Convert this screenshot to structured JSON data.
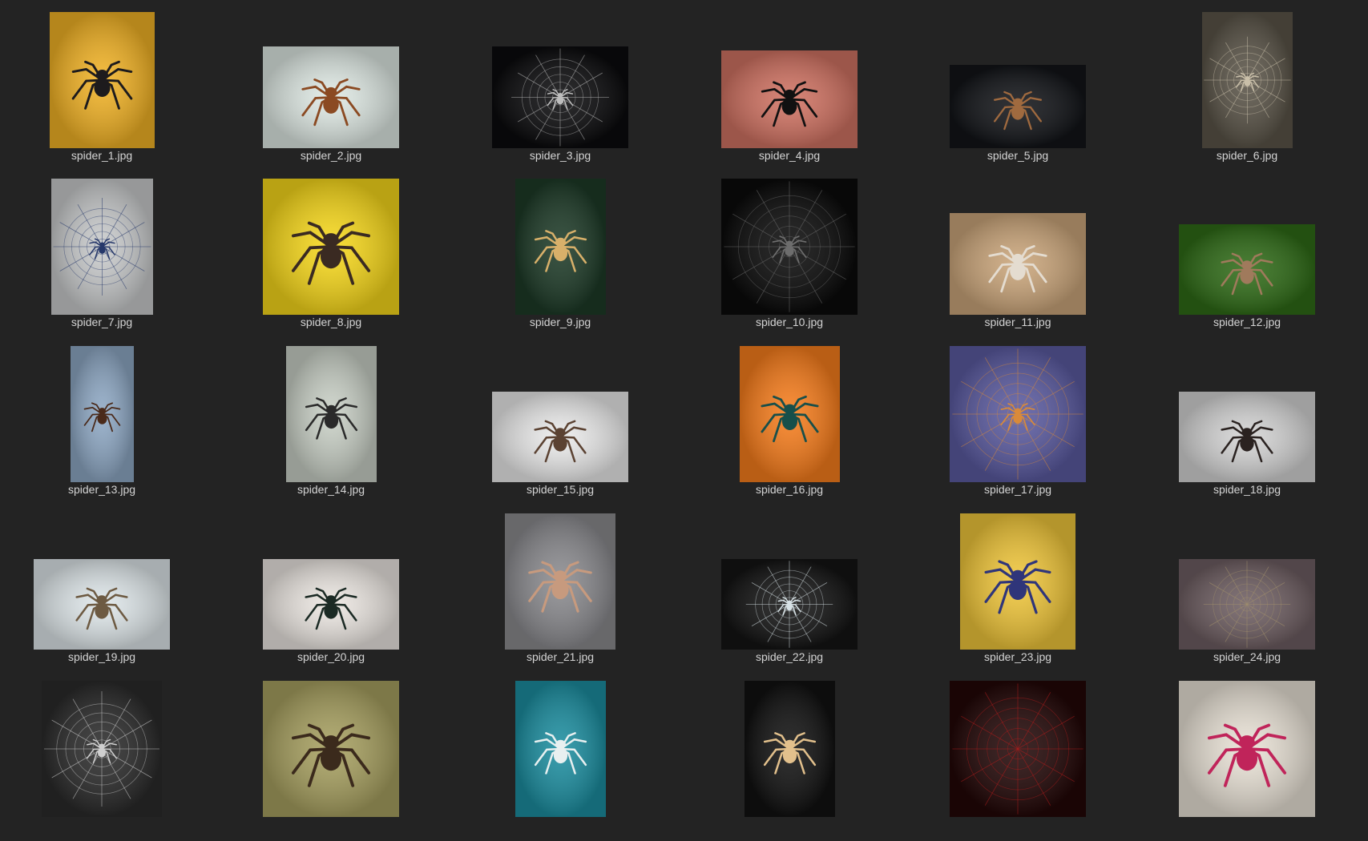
{
  "window": {
    "title": ""
  },
  "files": [
    {
      "name": "spider_1.jpg",
      "bg": "#f1b225",
      "fg": "#1d1b1d",
      "icon": "tarantula-on-yellow-image"
    },
    {
      "name": "spider_2.jpg",
      "bg": "#dfe9e4",
      "fg": "#8b4a22",
      "icon": "orb-weaver-image"
    },
    {
      "name": "spider_3.jpg",
      "bg": "#0b0b0d",
      "fg": "#bdbdbd",
      "icon": "spider-on-web-dark-image"
    },
    {
      "name": "spider_4.jpg",
      "bg": "#d07262",
      "fg": "#111111",
      "icon": "spider-silhouette-pink-image"
    },
    {
      "name": "spider_5.jpg",
      "bg": "#121418",
      "fg": "#a06a3f",
      "icon": "jumping-spider-dark-image"
    },
    {
      "name": "spider_6.jpg",
      "bg": "#5a5448",
      "fg": "#c9bfa9",
      "icon": "web-in-forest-image"
    },
    {
      "name": "spider_7.jpg",
      "bg": "#c9cbcc",
      "fg": "#26386a",
      "icon": "blue-tarantula-web-image"
    },
    {
      "name": "spider_8.jpg",
      "bg": "#f7d81b",
      "fg": "#3a2a22",
      "icon": "tarantula-on-yellow-image"
    },
    {
      "name": "spider_9.jpg",
      "bg": "#1d3a27",
      "fg": "#d8b06a",
      "icon": "orb-weaver-green-image"
    },
    {
      "name": "spider_10.jpg",
      "bg": "#0a0a0a",
      "fg": "#6d6d6d",
      "icon": "spider-on-web-dark-image"
    },
    {
      "name": "spider_11.jpg",
      "bg": "#caa57a",
      "fg": "#e4dcd0",
      "icon": "sand-spider-image"
    },
    {
      "name": "spider_12.jpg",
      "bg": "#2f6b17",
      "fg": "#a07a5c",
      "icon": "jumping-spider-leaf-image"
    },
    {
      "name": "spider_13.jpg",
      "bg": "#8ea8c4",
      "fg": "#4a2a1a",
      "icon": "hanging-spider-sky-image"
    },
    {
      "name": "spider_14.jpg",
      "bg": "#c9d0c6",
      "fg": "#2a2a2a",
      "icon": "golden-silk-spider-image"
    },
    {
      "name": "spider_15.jpg",
      "bg": "#ebebeb",
      "fg": "#5b4232",
      "icon": "spider-on-white-image"
    },
    {
      "name": "spider_16.jpg",
      "bg": "#f77d1c",
      "fg": "#184f4a",
      "icon": "green-tarantula-orange-image"
    },
    {
      "name": "spider_17.jpg",
      "bg": "#5a5aa0",
      "fg": "#d98a3a",
      "icon": "purple-web-image"
    },
    {
      "name": "spider_18.jpg",
      "bg": "#d4d4d4",
      "fg": "#2a2220",
      "icon": "small-spider-gray-image"
    },
    {
      "name": "spider_19.jpg",
      "bg": "#dfe7ea",
      "fg": "#6d5a42",
      "icon": "jumping-spider-white-image"
    },
    {
      "name": "spider_20.jpg",
      "bg": "#ece7e2",
      "fg": "#1b2a24",
      "icon": "jumping-spider-white-image"
    },
    {
      "name": "spider_21.jpg",
      "bg": "#8a8a8e",
      "fg": "#c79a7e",
      "icon": "tarantula-closeup-image"
    },
    {
      "name": "spider_22.jpg",
      "bg": "#141414",
      "fg": "#d7e2e6",
      "icon": "web-closeup-image"
    },
    {
      "name": "spider_23.jpg",
      "bg": "#f0c63a",
      "fg": "#2f357a",
      "icon": "blue-tarantula-yellow-image"
    },
    {
      "name": "spider_24.jpg",
      "bg": "#6e5e62",
      "fg": "#a3916c",
      "icon": "web-in-field-image"
    },
    {
      "name": "",
      "bg": "#2a2a2a",
      "fg": "#cfcfcf",
      "icon": "web-dew-image"
    },
    {
      "name": "",
      "bg": "#a7a060",
      "fg": "#3b2a1c",
      "icon": "spider-leaf-image"
    },
    {
      "name": "",
      "bg": "#1c8ea0",
      "fg": "#e8f0f0",
      "icon": "argiope-blue-image"
    },
    {
      "name": "",
      "bg": "#111111",
      "fg": "#e2c08c",
      "icon": "orb-weaver-night-image"
    },
    {
      "name": "",
      "bg": "#220707",
      "fg": "#b51c1c",
      "icon": "red-web-image"
    },
    {
      "name": "",
      "bg": "#e9e2d6",
      "fg": "#c0245a",
      "icon": "spider-flower-image"
    }
  ]
}
